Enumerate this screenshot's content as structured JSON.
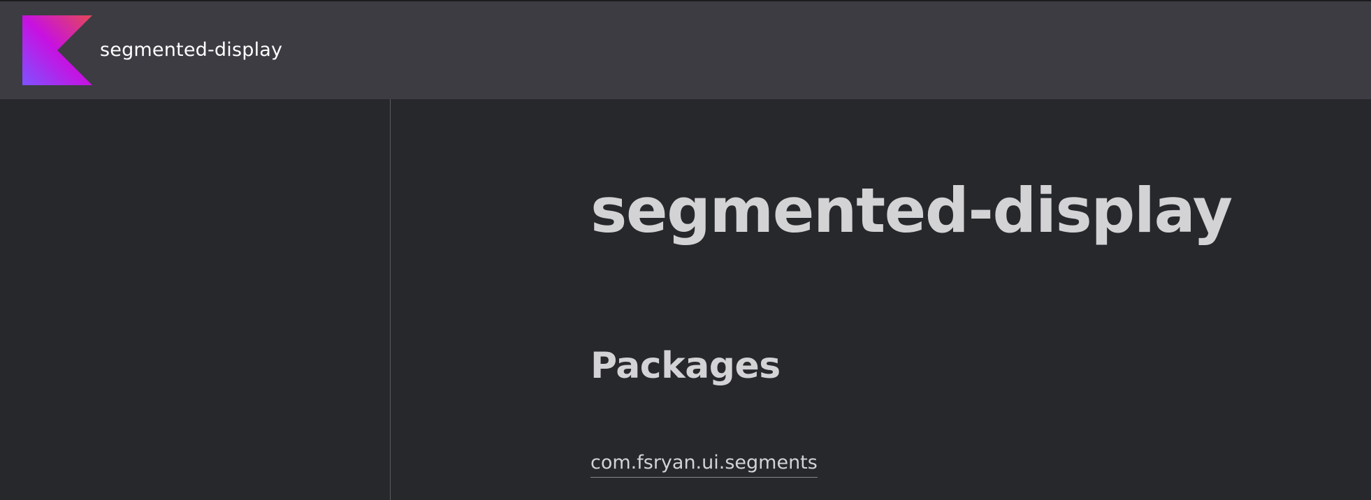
{
  "header": {
    "logo_icon": "kotlin-logo-icon",
    "title": "segmented-display"
  },
  "main": {
    "title": "segmented-display",
    "packages_heading": "Packages",
    "packages": [
      {
        "name": "com.fsryan.ui.segments"
      }
    ]
  },
  "colors": {
    "header_bg": "#3d3c43",
    "page_bg": "#27282c",
    "text": "#d3d3d5",
    "logo_gradient": [
      "#7f52ff",
      "#c711e1",
      "#e44857"
    ]
  }
}
